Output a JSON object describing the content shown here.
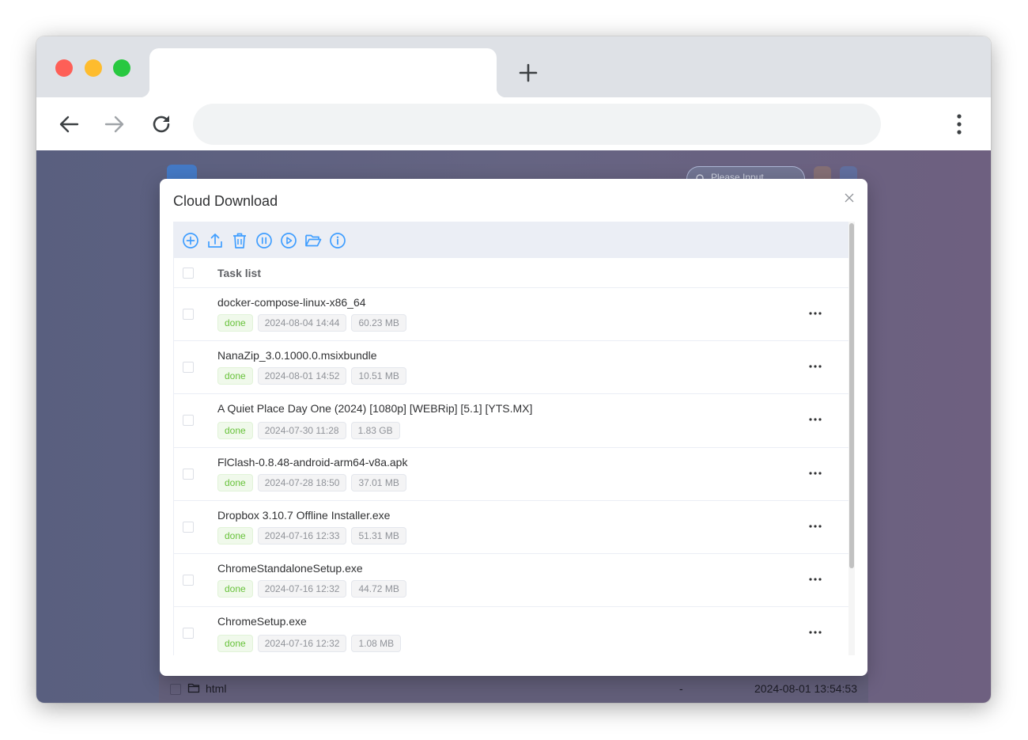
{
  "browser": {
    "tab_title": "",
    "address": ""
  },
  "background": {
    "search_placeholder": "Please Input",
    "row": {
      "name": "html",
      "size": "-",
      "date": "2024-08-01 13:54:53"
    }
  },
  "dialog": {
    "title": "Cloud Download",
    "toolbar_icons": [
      "add-circle-icon",
      "upload-icon",
      "trash-icon",
      "pause-icon",
      "play-icon",
      "folder-open-icon",
      "info-icon"
    ],
    "accent_color": "#409eff",
    "table": {
      "header": "Task list",
      "rows": [
        {
          "name": "docker-compose-linux-x86_64",
          "status": "done",
          "date": "2024-08-04 14:44",
          "size": "60.23 MB"
        },
        {
          "name": "NanaZip_3.0.1000.0.msixbundle",
          "status": "done",
          "date": "2024-08-01 14:52",
          "size": "10.51 MB"
        },
        {
          "name": "A Quiet Place Day One (2024) [1080p] [WEBRip] [5.1] [YTS.MX]",
          "status": "done",
          "date": "2024-07-30 11:28",
          "size": "1.83 GB"
        },
        {
          "name": "FlClash-0.8.48-android-arm64-v8a.apk",
          "status": "done",
          "date": "2024-07-28 18:50",
          "size": "37.01 MB"
        },
        {
          "name": "Dropbox 3.10.7 Offline Installer.exe",
          "status": "done",
          "date": "2024-07-16 12:33",
          "size": "51.31 MB"
        },
        {
          "name": "ChromeStandaloneSetup.exe",
          "status": "done",
          "date": "2024-07-16 12:32",
          "size": "44.72 MB"
        },
        {
          "name": "ChromeSetup.exe",
          "status": "done",
          "date": "2024-07-16 12:32",
          "size": "1.08 MB"
        }
      ]
    }
  }
}
